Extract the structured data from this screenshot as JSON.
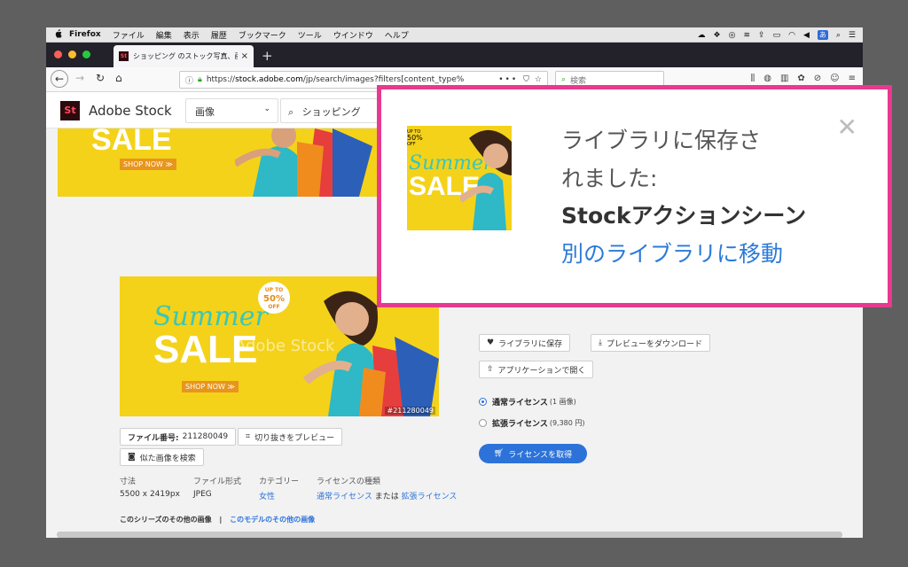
{
  "menubar": {
    "apple": "",
    "app": "Firefox",
    "items": [
      "ファイル",
      "編集",
      "表示",
      "履歴",
      "ブックマーク",
      "ツール",
      "ウインドウ",
      "ヘルプ"
    ],
    "ime": "あ"
  },
  "tab": {
    "title": "ショッピング のストック写真、画",
    "close": "×",
    "new_tab": "+"
  },
  "navbar": {
    "url_scheme": "https://",
    "url_host": "stock.adobe.com",
    "url_path": "/jp/search/images?filters[content_type%",
    "url_tail": "•••",
    "search_placeholder": "検索"
  },
  "stock_header": {
    "logo": "St",
    "brand": "Adobe Stock",
    "category": "画像",
    "search_value": "ショッピング"
  },
  "top_banner": {
    "sale": "SALE",
    "shop_now": "SHOP NOW ≫"
  },
  "main_banner": {
    "summer": "Summer",
    "sale": "SALE",
    "shop_now": "SHOP NOW ≫",
    "badge_line1": "UP TO",
    "badge_line2": "50%",
    "badge_line3": "OFF",
    "watermark": "Adobe Stock",
    "file_tag": "#211280049"
  },
  "file_info": {
    "file_number_label": "ファイル番号:",
    "file_number": "211280049",
    "crop_preview": "切り抜きをプレビュー",
    "similar_search": "似た画像を検索"
  },
  "meta": {
    "size_label": "寸法",
    "size_value": "5500 x 2419px",
    "format_label": "ファイル形式",
    "format_value": "JPEG",
    "category_label": "カテゴリー",
    "category_value": "女性",
    "license_type_label": "ライセンスの種類",
    "license_standard": "通常ライセンス",
    "license_or": "または",
    "license_extended": "拡張ライセンス"
  },
  "series": {
    "series_link": "このシリーズのその他の画像",
    "separator": "|",
    "model_link": "このモデルのその他の画像"
  },
  "actions": {
    "save_library": "ライブラリに保存",
    "preview_download": "プレビューをダウンロード",
    "open_app": "アプリケーションで開く"
  },
  "license": {
    "standard_label": "通常ライセンス",
    "standard_sub": "(1 画像)",
    "extended_label": "拡張ライセンス",
    "extended_sub": "(9,380 円)",
    "get_license": "ライセンスを取得"
  },
  "popup": {
    "message_line1": "ライブラリに保存さ",
    "message_line2": "れました:",
    "library_name": "Stockアクションシーン",
    "move_link": "別のライブラリに移動",
    "close": "✕"
  },
  "colors": {
    "accent_blue": "#2c72d8",
    "popup_border": "#e73a8f",
    "banner_yellow": "#f4d21a"
  }
}
